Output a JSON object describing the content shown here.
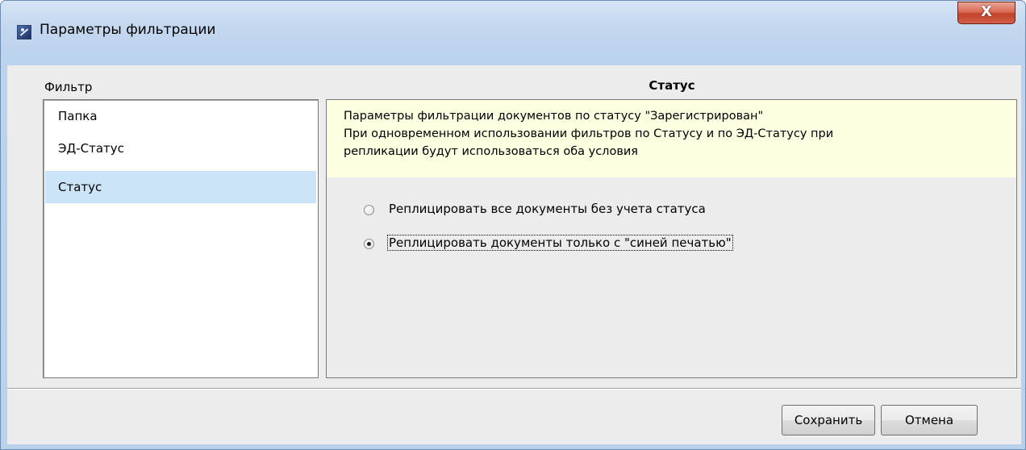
{
  "window": {
    "title": "Параметры фильтрации",
    "close_label": "X"
  },
  "filter": {
    "label": "Фильтр",
    "items": [
      {
        "label": "Папка",
        "selected": false
      },
      {
        "label": "ЭД-Статус",
        "selected": false
      },
      {
        "label": "Статус",
        "selected": true
      }
    ]
  },
  "detail": {
    "title": "Статус",
    "info_lines": [
      "Параметры фильтрации документов по статусу \"Зарегистрирован\"",
      "При одновременном использовании фильтров по Статусу и по ЭД-Статусу при",
      "репликации будут использоваться оба условия"
    ],
    "options": [
      {
        "label": "Реплицировать все документы без учета статуса",
        "checked": false
      },
      {
        "label": "Реплицировать документы только с \"синей печатью\"",
        "checked": true
      }
    ]
  },
  "buttons": {
    "save": "Сохранить",
    "cancel": "Отмена"
  },
  "colors": {
    "selected_item": "#cce4f7",
    "info_background": "#ffffe1",
    "close_button": "#c5412b"
  }
}
